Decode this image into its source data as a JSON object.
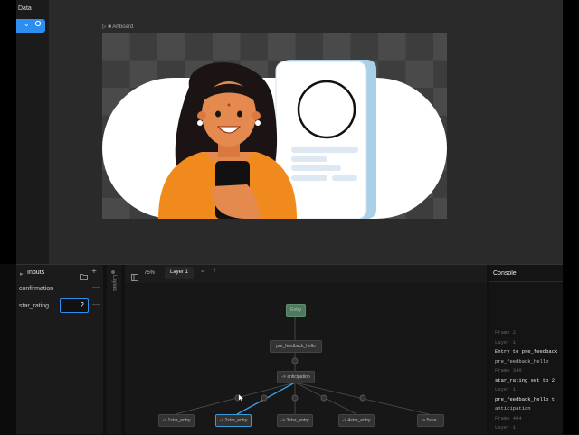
{
  "sidebar": {
    "title": "Data",
    "chip_chevron": "⌄",
    "chip_icon": "sync-icon"
  },
  "canvas": {
    "artboard_label": "Artboard"
  },
  "inputs": {
    "title": "Inputs",
    "rows": [
      {
        "name": "confirmation",
        "value": ""
      },
      {
        "name": "star_rating",
        "value": "2"
      }
    ]
  },
  "layers_label": "Layers",
  "graph": {
    "zoom": "75%",
    "tab": "Layer 1",
    "nodes": {
      "entry": "Entry",
      "pre": "pre_feedback_hello",
      "anticipation": "-> anticipation",
      "b1": "-> 1star_entry",
      "b2": "-> 2star_entry",
      "b3": "-> 3star_entry",
      "b4": "-> 4star_entry",
      "b5": "-> 5star..."
    }
  },
  "console": {
    "title": "Console",
    "lines": [
      {
        "text": "Frame 2",
        "style": "dim"
      },
      {
        "text": "Layer 1",
        "style": "dim"
      },
      {
        "text": "Entry to pre_feedback",
        "style": "bright"
      },
      {
        "text": "pre_feedback_hello",
        "style": "mid"
      },
      {
        "text": "Frame 349",
        "style": "dim"
      },
      {
        "text": "star_rating set to 2",
        "style": "bright"
      },
      {
        "text": "Layer 1",
        "style": "dim"
      },
      {
        "text": "pre_feedback_hello t",
        "style": "bright"
      },
      {
        "text": "anticipation",
        "style": "mid"
      },
      {
        "text": "Frame 494",
        "style": "dim"
      },
      {
        "text": "Layer 1",
        "style": "dim"
      }
    ]
  },
  "colors": {
    "accent": "#2d8ef0",
    "entry_node": "#4c7a5e",
    "orange": "#f08a1c"
  }
}
